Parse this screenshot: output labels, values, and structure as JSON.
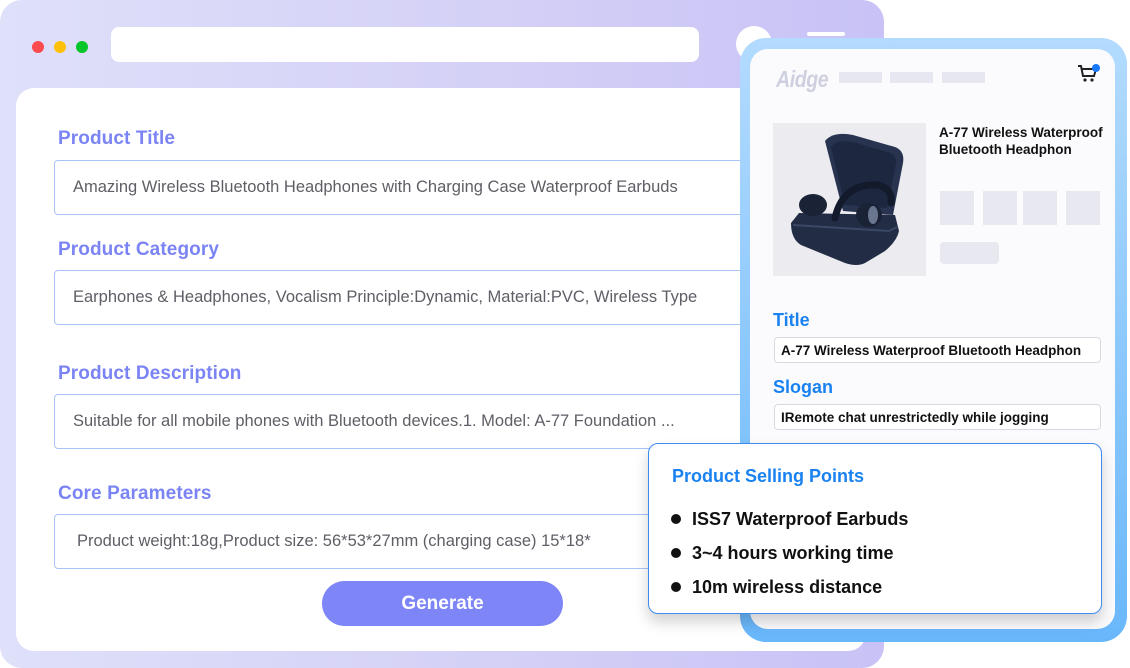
{
  "browser": {
    "window_controls": [
      "close",
      "minimize",
      "maximize"
    ]
  },
  "form": {
    "fields": [
      {
        "label": "Product Title",
        "value": "Amazing Wireless Bluetooth Headphones with Charging Case Waterproof Earbuds"
      },
      {
        "label": "Product Category",
        "value": "Earphones & Headphones, Vocalism Principle:Dynamic, Material:PVC, Wireless Type"
      },
      {
        "label": "Product Description",
        "value": "Suitable for all mobile phones with Bluetooth devices.1. Model: A-77 Foundation ..."
      },
      {
        "label": "Core Parameters",
        "value": "Product weight:18g,Product size: 56*53*27mm (charging case) 15*18*"
      }
    ],
    "generate_label": "Generate"
  },
  "preview": {
    "brand": "Aidge",
    "cart_icon": "shopping-cart-icon",
    "badge_color": "#1677ff",
    "product_name": "A-77 Wireless Waterproof Bluetooth Headphon",
    "title_label": "Title",
    "title_value": "A-77 Wireless Waterproof Bluetooth Headphon",
    "slogan_label": "Slogan",
    "slogan_value": "IRemote chat unrestrictedly while jogging"
  },
  "selling_points": {
    "title": "Product Selling Points",
    "items": [
      "ISS7 Waterproof Earbuds",
      "3~4 hours working time",
      "10m wireless distance"
    ]
  },
  "colors": {
    "form_label": "#7b84f4",
    "generate_button": "#7e86f7",
    "preview_accent": "#1a82f0",
    "phone_frame": "#69b7fb",
    "browser_frame": "#d3cff6"
  }
}
